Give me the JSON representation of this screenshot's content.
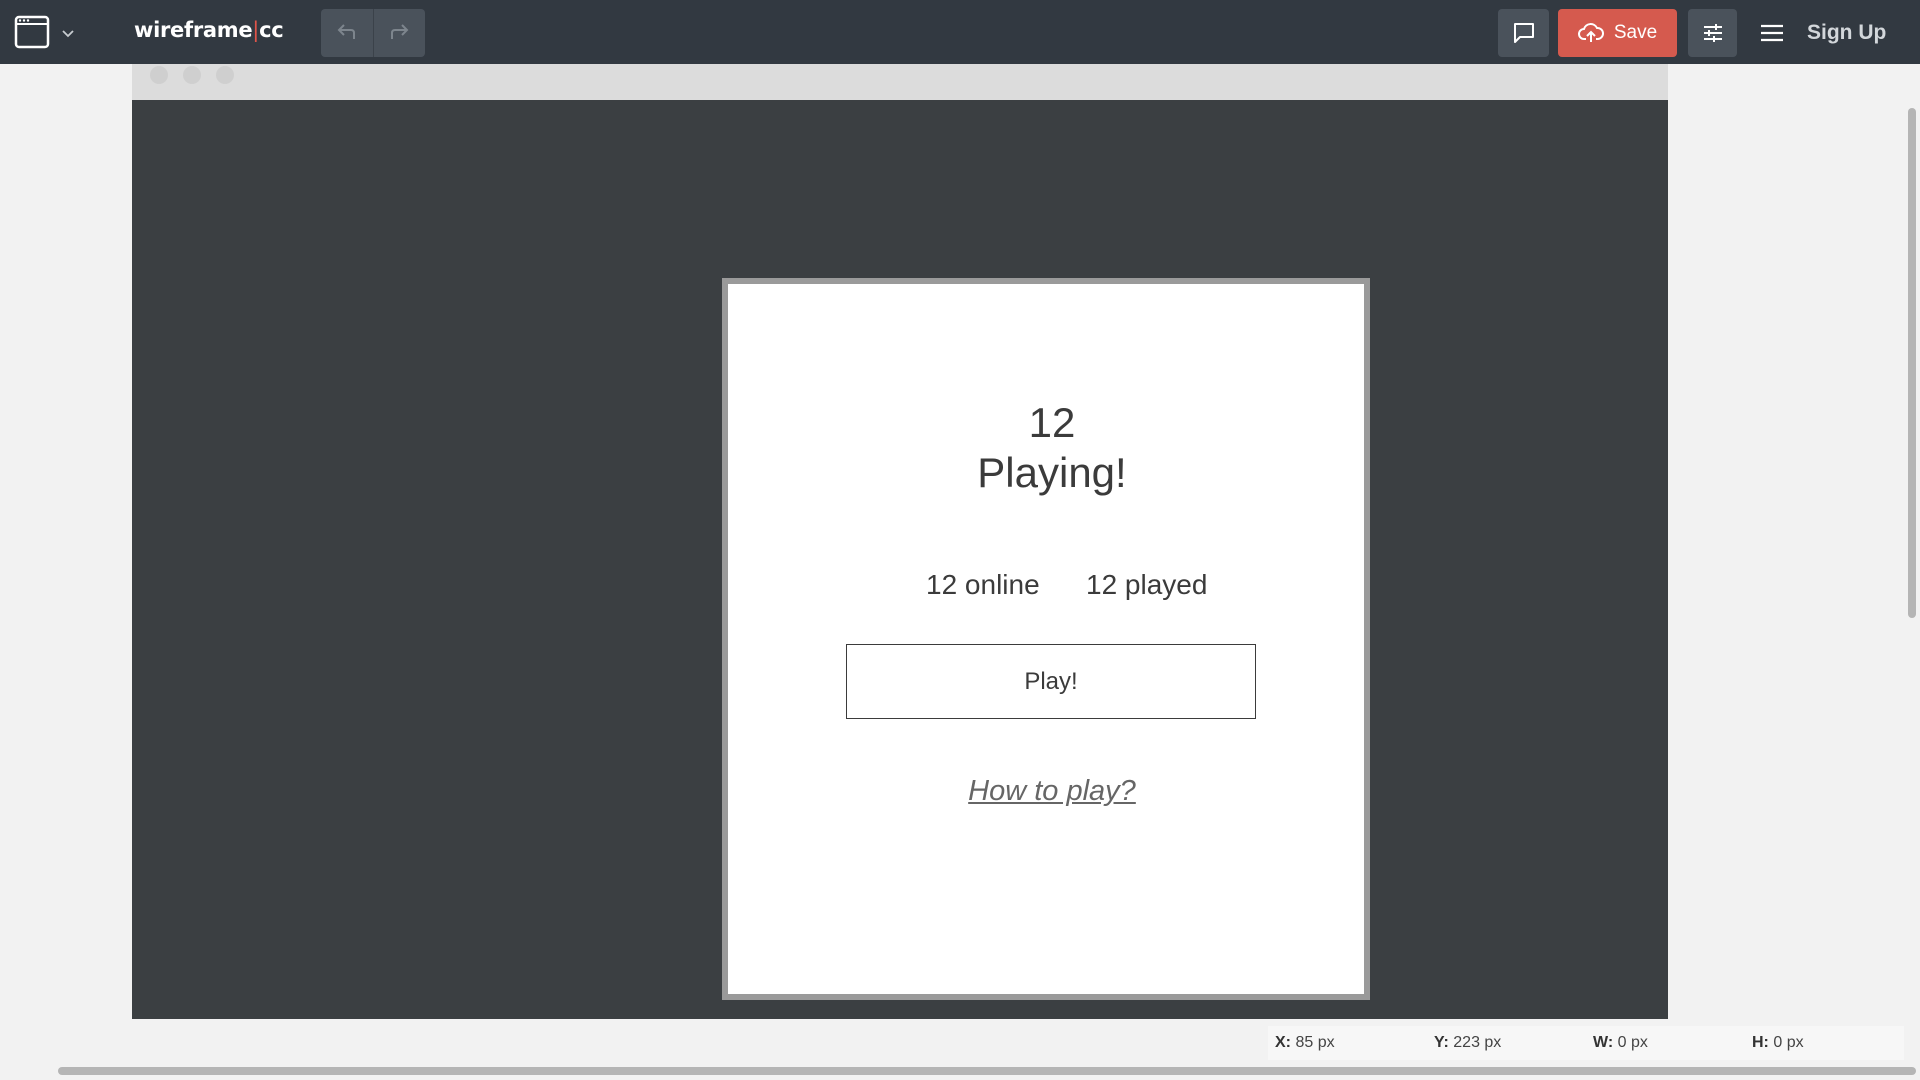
{
  "toolbar": {
    "logo_main": "wireframe",
    "logo_sep": "|",
    "logo_suffix": "cc",
    "save_label": "Save",
    "signup_label": "Sign Up",
    "icons": [
      "browser-frame-icon",
      "chevron-down-icon",
      "undo-icon",
      "redo-icon",
      "comment-icon",
      "cloud-upload-icon",
      "sliders-icon",
      "hamburger-menu-icon"
    ]
  },
  "wireframe": {
    "count": "12",
    "status": "Playing!",
    "online": "12 online",
    "played": "12 played",
    "play_button": "Play!",
    "how_to_play": "How to play?"
  },
  "statusbar": {
    "x_label": "X:",
    "x_value": "85 px",
    "y_label": "Y:",
    "y_value": "223 px",
    "w_label": "W:",
    "w_value": "0 px",
    "h_label": "H:",
    "h_value": "0 px"
  },
  "colors": {
    "toolbar_bg": "#323941",
    "save_button": "#d55a4e",
    "canvas_bg": "#3b3f42",
    "logo_accent": "#e0554a"
  }
}
